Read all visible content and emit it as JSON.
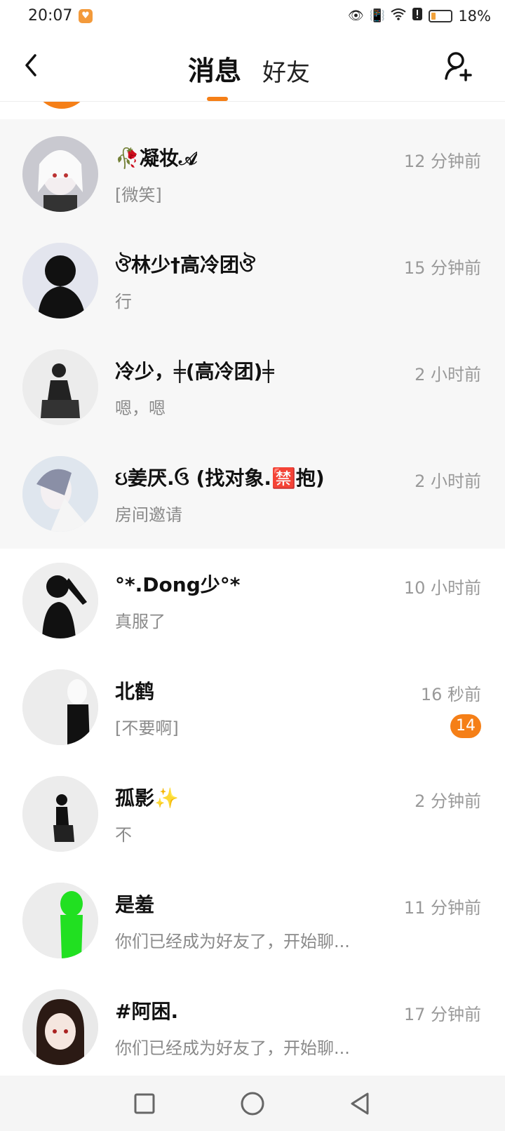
{
  "status_bar": {
    "time": "20:07",
    "battery": "18%",
    "battery_level": 0.18,
    "icons": [
      "app-notification-icon",
      "eye-icon",
      "vibrate-icon",
      "wifi-icon",
      "alert-icon",
      "battery-icon"
    ]
  },
  "header": {
    "tab_messages": "消息",
    "tab_friends": "好友",
    "accent": "#f57f17"
  },
  "conversations": [
    {
      "name": "🥀凝妆𝒜",
      "preview": "[微笑]",
      "time": "12 分钟前",
      "pinned": true
    },
    {
      "name": "ঔ林少†高冷团ঔ",
      "preview": "行",
      "time": "15 分钟前",
      "pinned": true
    },
    {
      "name": "冷少，╪(高冷团)╪",
      "preview": "嗯，嗯",
      "time": "2 小时前",
      "pinned": true
    },
    {
      "name": "ઇ姜厌.ઉ (找对象.🈲抱)",
      "preview": "房间邀请",
      "time": "2 小时前",
      "pinned": true
    },
    {
      "name": "°*.Dong少°*",
      "preview": "真服了",
      "time": "10 小时前",
      "pinned": false
    },
    {
      "name": "北鹤",
      "preview": "[不要啊]",
      "time": "16 秒前",
      "pinned": false,
      "unread": "14"
    },
    {
      "name": "孤影✨",
      "preview": "不",
      "time": "2 分钟前",
      "pinned": false
    },
    {
      "name": "是羞",
      "preview": "你们已经成为好友了，开始聊...",
      "time": "11 分钟前",
      "pinned": false
    },
    {
      "name": "#阿困.",
      "preview": "你们已经成为好友了，开始聊...",
      "time": "17 分钟前",
      "pinned": false
    }
  ]
}
